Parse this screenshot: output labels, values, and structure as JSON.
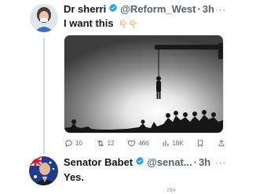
{
  "tweet1": {
    "name": "Dr sherri",
    "handle": "@Reform_West",
    "separator": "·",
    "time": "3h",
    "text": "I want this",
    "emoji": "👇🏻👇🏻",
    "more": "···",
    "stats": {
      "replies": "10",
      "reposts": "12",
      "likes": "466",
      "views": "18K"
    }
  },
  "tweet2": {
    "name": "Senator Babet",
    "handle": "@senat...",
    "separator": "·",
    "time": "3h",
    "text": "Yes.",
    "more": "···",
    "views_partial": "284"
  },
  "colors": {
    "text": "#0f1419",
    "secondary": "#536471",
    "verified": "#1d9bf0",
    "thread_line": "#cfd9de"
  },
  "icons": [
    "verified-badge-icon",
    "reply-icon",
    "repost-icon",
    "like-icon",
    "views-icon",
    "bookmark-icon",
    "share-icon",
    "more-icon"
  ]
}
